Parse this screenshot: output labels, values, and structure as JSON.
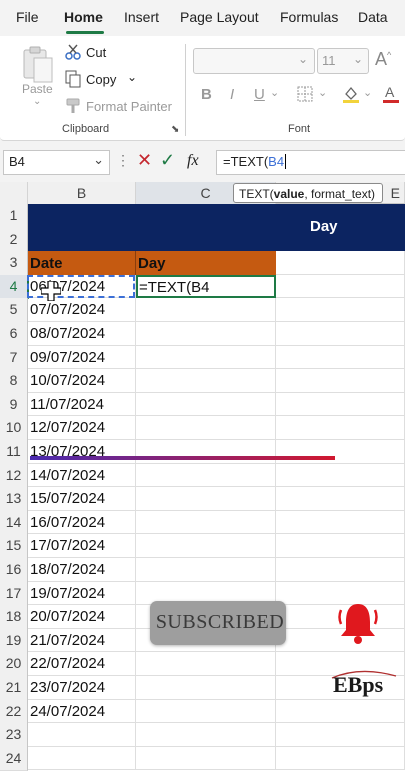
{
  "menu": {
    "items": [
      "File",
      "Home",
      "Insert",
      "Page Layout",
      "Formulas",
      "Data"
    ],
    "active": "Home"
  },
  "ribbon": {
    "clipboard": {
      "paste": "Paste",
      "cut": "Cut",
      "copy": "Copy",
      "format_painter": "Format Painter",
      "group_label": "Clipboard"
    },
    "font": {
      "font_name": "",
      "font_size": "11",
      "bold": "B",
      "italic": "I",
      "underline": "U",
      "group_label": "Font"
    }
  },
  "formula_bar": {
    "name_box": "B4",
    "fx_label": "fx",
    "formula_prefix": "=TEXT(",
    "formula_ref": "B4",
    "ref_color": "#3b6fd6"
  },
  "tooltip": {
    "func": "TEXT(",
    "arg_bold": "value",
    "rest": ", format_text)"
  },
  "columns": [
    "B",
    "C",
    "E"
  ],
  "rows": [
    "1",
    "2",
    "3",
    "4",
    "5",
    "6",
    "7",
    "8",
    "9",
    "10",
    "11",
    "12",
    "13",
    "14",
    "15",
    "16",
    "17",
    "18",
    "19",
    "20",
    "21",
    "22",
    "23",
    "24"
  ],
  "sheet": {
    "banner_text": "Day",
    "banner_color": "#0c2461",
    "header_color": "#c55a11",
    "header_date": "Date",
    "header_day": "Day",
    "editing_cell_text": "=TEXT(B4",
    "dates": [
      "06/07/2024",
      "07/07/2024",
      "08/07/2024",
      "09/07/2024",
      "10/07/2024",
      "11/07/2024",
      "12/07/2024",
      "13/07/2024",
      "14/07/2024",
      "15/07/2024",
      "16/07/2024",
      "17/07/2024",
      "18/07/2024",
      "19/07/2024",
      "20/07/2024",
      "21/07/2024",
      "22/07/2024",
      "23/07/2024",
      "24/07/2024"
    ]
  },
  "overlay": {
    "subscribe_label": "SUBSCRIBED",
    "watermark": "EBps"
  }
}
